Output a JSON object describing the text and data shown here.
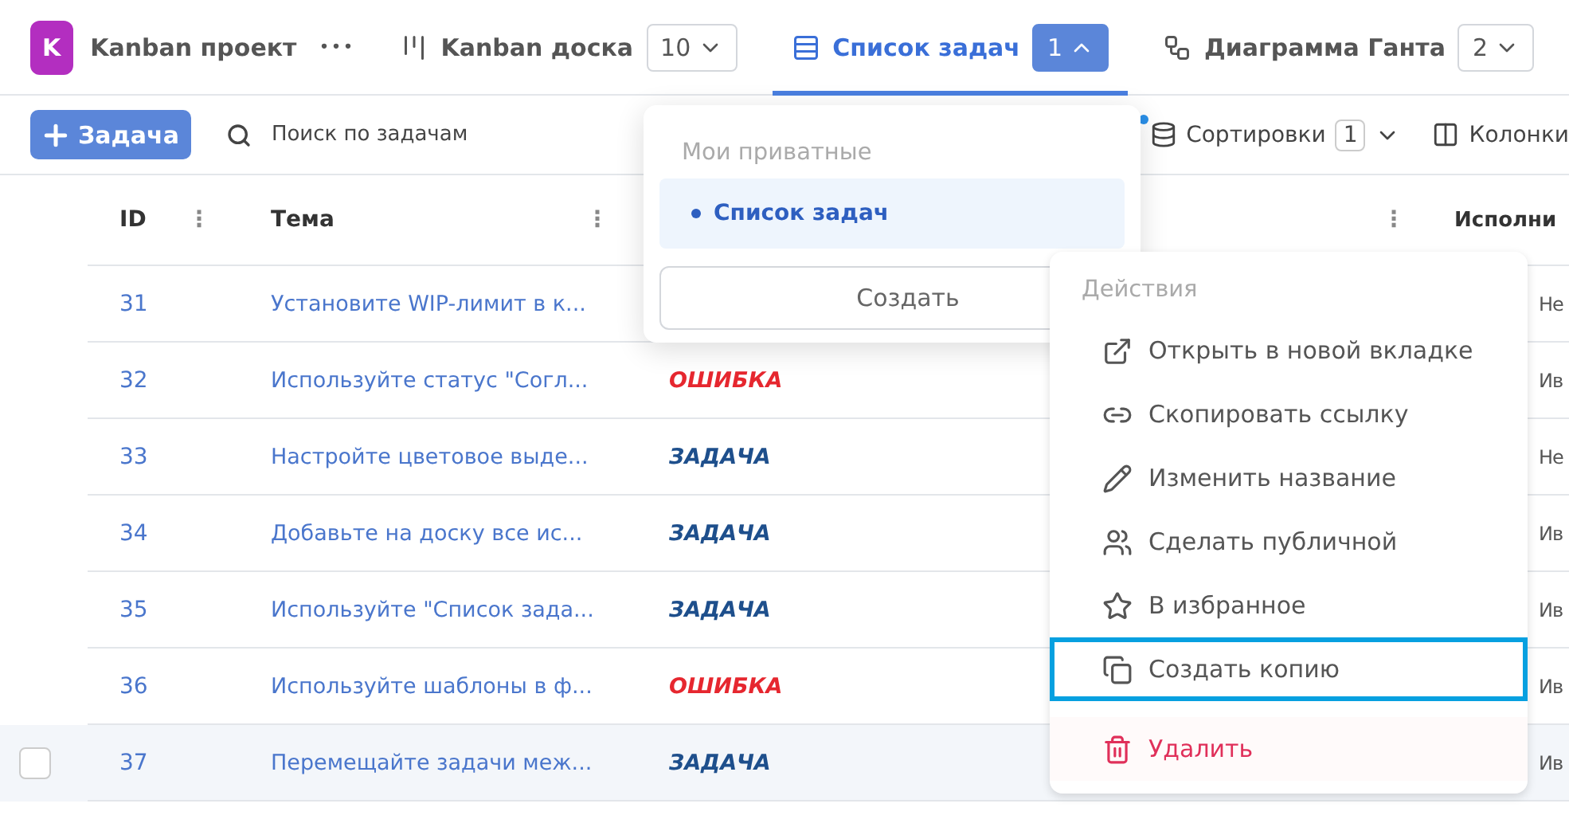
{
  "project": {
    "avatar": "K",
    "name": "Kanban проект",
    "more": "•••"
  },
  "views": [
    {
      "kind": "board",
      "label": "Kanban доска",
      "count": "10",
      "selected": false
    },
    {
      "kind": "list",
      "label": "Список задач",
      "count": "1",
      "selected": true
    },
    {
      "kind": "gantt",
      "label": "Диаграмма Ганта",
      "count": "2",
      "selected": false
    }
  ],
  "toolbar": {
    "add_button": "Задача",
    "search_placeholder": "Поиск по задачам",
    "sort_label": "Сортировки",
    "sort_count": "1",
    "columns_label": "Колонки"
  },
  "table": {
    "columns": [
      {
        "label": "ID",
        "menu": "⋮"
      },
      {
        "label": "Тема",
        "menu": "⋮"
      },
      {
        "menu": "⋮"
      },
      {
        "label": "Исполни"
      }
    ],
    "rows": [
      {
        "id": "31",
        "title": "Установите WIP-лимит в к...",
        "assignee": "Не",
        "selected": false
      },
      {
        "id": "32",
        "title": "Используйте статус \"Согл...",
        "type": "ОШИБКА",
        "color": "#e6272f",
        "assignee": "Ив",
        "selected": false
      },
      {
        "id": "33",
        "title": "Настройте цветовое выде...",
        "type": "ЗАДАЧА",
        "color": "#1e4f8c",
        "assignee": "Не",
        "selected": false
      },
      {
        "id": "34",
        "title": "Добавьте на доску все ис...",
        "type": "ЗАДАЧА",
        "color": "#1e4f8c",
        "assignee": "Ив",
        "selected": false
      },
      {
        "id": "35",
        "title": "Используйте \"Список зада...",
        "type": "ЗАДАЧА",
        "color": "#1e4f8c",
        "assignee": "Ив",
        "selected": false
      },
      {
        "id": "36",
        "title": "Используйте шаблоны в ф...",
        "type": "ОШИБКА",
        "color": "#e6272f",
        "assignee": "Ив",
        "selected": false
      },
      {
        "id": "37",
        "title": "Перемещайте задачи меж...",
        "type": "ЗАДАЧА",
        "color": "#1e4f8c",
        "assignee": "Ив",
        "selected": true
      }
    ]
  },
  "views_dropdown": {
    "section": "Мои приватные",
    "items": [
      {
        "label": "Список задач",
        "selected": true
      }
    ],
    "create_button": "Создать"
  },
  "context_menu": {
    "title": "Действия",
    "items": [
      {
        "kind": "open",
        "label": "Открыть в новой вкладке",
        "highlighted": false,
        "danger": false
      },
      {
        "kind": "link",
        "label": "Скопировать ссылку",
        "highlighted": false,
        "danger": false
      },
      {
        "kind": "rename",
        "label": "Изменить название",
        "highlighted": false,
        "danger": false
      },
      {
        "kind": "public",
        "label": "Сделать публичной",
        "highlighted": false,
        "danger": false
      },
      {
        "kind": "favorite",
        "label": "В избранное",
        "highlighted": false,
        "danger": false
      },
      {
        "kind": "copy",
        "label": "Создать копию",
        "highlighted": true,
        "danger": false
      },
      {
        "kind": "delete",
        "label": "Удалить",
        "highlighted": false,
        "danger": true
      }
    ]
  }
}
